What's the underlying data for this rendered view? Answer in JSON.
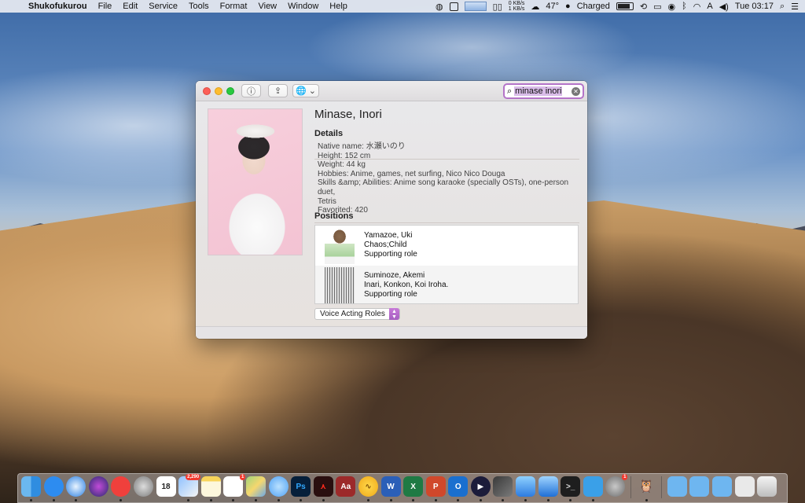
{
  "menubar": {
    "apple": "",
    "app_name": "Shukofukurou",
    "menus": [
      "File",
      "Edit",
      "Service",
      "Tools",
      "Format",
      "View",
      "Window",
      "Help"
    ],
    "net_up": "0 KB/s",
    "net_down": "1 KB/s",
    "temperature": "47°",
    "battery_status": "Charged",
    "input_source": "A",
    "clock": "Tue 03:17"
  },
  "window": {
    "search": {
      "value": "minase inori"
    },
    "toolbar": {
      "info_label": "ⓘ",
      "share_label": "⇪",
      "web_label": "🌐 ⌄"
    },
    "person_name": "Minase, Inori",
    "details_header": "Details",
    "details": [
      "Native name: 水瀬いのり",
      "Height: 152 cm",
      "Weight: 44 kg",
      "Hobbies: Anime, games, net surfing, Nico Nico Douga",
      "Skills &amp; Abilities: Anime song karaoke (specially OSTs), one-person duet,",
      "Tetris",
      "Favorited: 420"
    ],
    "positions_header": "Positions",
    "positions": [
      {
        "name": "Yamazoe, Uki",
        "anime": "Chaos;Child",
        "role": "Supporting role"
      },
      {
        "name": "Suminoze, Akemi",
        "anime": "Inari, Konkon, Koi Iroha.",
        "role": "Supporting role"
      }
    ],
    "role_select": {
      "value": "Voice Acting Roles"
    }
  },
  "dock": {
    "calendar_day": "18",
    "photos_badge": "2,290",
    "reminders_badge": "1",
    "app_badge": "1",
    "icons": [
      "finder-icon",
      "app-store-icon",
      "safari-icon",
      "siri-icon",
      "news-icon",
      "launchpad-icon",
      "calendar-icon",
      "preview-icon",
      "notes-icon",
      "reminders-icon",
      "maps-icon",
      "messages-icon",
      "photoshop-icon",
      "acrobat-icon",
      "dictionary-icon",
      "audio-icon",
      "word-icon",
      "excel-icon",
      "powerpoint-icon",
      "outlook-icon",
      "infuse-icon",
      "final-cut-icon",
      "archive-icon",
      "xcode-icon",
      "terminal-icon",
      "tweetbot-icon",
      "system-preferences-icon",
      "owl-app-icon",
      "applications-folder-icon",
      "documents-folder-icon",
      "downloads-folder-icon",
      "mail-folder-icon",
      "trash-icon"
    ]
  }
}
